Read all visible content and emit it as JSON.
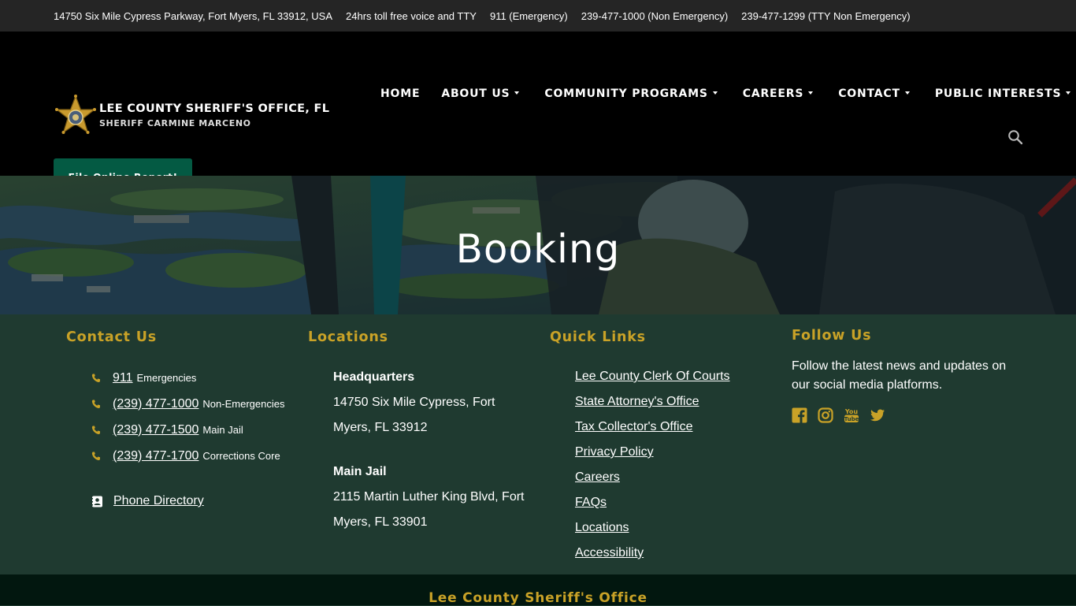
{
  "topbar": {
    "address": "14750 Six Mile Cypress Parkway, Fort Myers, FL 33912, USA",
    "tollfree": "24hrs toll free voice and TTY",
    "emergency": "911 (Emergency)",
    "non_emergency": "239-477-1000 (Non Emergency)",
    "tty": "239-477-1299 (TTY Non Emergency)"
  },
  "brand": {
    "title": "LEE COUNTY SHERIFF'S OFFICE, FL",
    "subtitle": "SHERIFF CARMINE MARCENO",
    "logo_icon": "sheriff-star-badge-icon"
  },
  "nav": {
    "items": [
      {
        "label": "HOME",
        "dropdown": false
      },
      {
        "label": "ABOUT US",
        "dropdown": true
      },
      {
        "label": "COMMUNITY PROGRAMS",
        "dropdown": true
      },
      {
        "label": "CAREERS",
        "dropdown": true
      },
      {
        "label": "CONTACT",
        "dropdown": true
      },
      {
        "label": "PUBLIC INTERESTS",
        "dropdown": true
      }
    ],
    "search_icon": "search-icon"
  },
  "report_button": "File Online Report!",
  "hero": {
    "title": "Booking"
  },
  "footer": {
    "contact": {
      "heading": "Contact Us",
      "items": [
        {
          "number": "911",
          "label": "Emergencies"
        },
        {
          "number": "(239) 477-1000",
          "label": "Non-Emergencies"
        },
        {
          "number": "(239) 477-1500",
          "label": "Main Jail"
        },
        {
          "number": "(239) 477-1700",
          "label": "Corrections Core"
        }
      ],
      "directory": "Phone Directory"
    },
    "locations": {
      "heading": "Locations",
      "items": [
        {
          "name": "Headquarters",
          "line1": "14750 Six Mile Cypress, Fort",
          "line2": "Myers, FL 33912"
        },
        {
          "name": "Main Jail",
          "line1": "2115 Martin Luther King Blvd, Fort",
          "line2": "Myers, FL 33901"
        }
      ]
    },
    "quick_links": {
      "heading": "Quick Links",
      "items": [
        "Lee County Clerk Of Courts",
        "State Attorney's Office",
        "Tax Collector's Office",
        "Privacy Policy",
        "Careers",
        "FAQs",
        "Locations",
        "Accessibility"
      ]
    },
    "follow": {
      "heading": "Follow Us",
      "text": "Follow the latest news and updates on our social media platforms.",
      "icons": [
        "facebook-icon",
        "instagram-icon",
        "youtube-icon",
        "twitter-icon"
      ]
    },
    "bottom_title": "Lee County Sheriff's Office"
  },
  "colors": {
    "topbar": "#252525",
    "header": "#000000",
    "button": "#045a43",
    "footer": "#1f3a30",
    "accent_gold": "#c9a227",
    "bottom_bar": "#02170f"
  }
}
